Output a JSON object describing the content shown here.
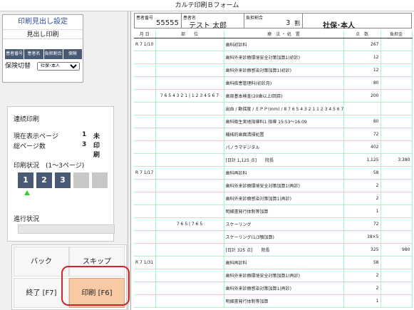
{
  "window": {
    "title": "カルテ印刷Ｂフォーム"
  },
  "settings": {
    "title": "印刷見出し設定",
    "subtitle": "見出し印刷",
    "tabs": [
      "患者番号",
      "患者名",
      "負担割合",
      "保険"
    ],
    "insurance_label": "保険切替",
    "insurance_selected": "社保･本人"
  },
  "continuous": {
    "title": "連続印刷",
    "current_label": "現在表示ページ",
    "current_value": "1",
    "current_status": "未印刷",
    "total_label": "総ページ数",
    "total_value": "3",
    "status_label": "印刷状況　(1〜3ページ)",
    "pages": [
      "1",
      "2",
      "3"
    ],
    "progress_label": "進行状況",
    "progress": 0
  },
  "buttons": {
    "back": "バック",
    "skip": "スキップ",
    "exit": "終了 [F7]",
    "print": "印刷 [F6]"
  },
  "header": {
    "patient_no_label": "患者番号",
    "patient_no": "55555",
    "patient_name_label": "患者名",
    "patient_name": "テスト 太郎",
    "ratio_label": "負担割合",
    "ratio": "3",
    "ratio_unit": "割",
    "insurance": "社保･本人"
  },
  "table": {
    "columns": [
      "月 日",
      "部　　位",
      "療　法 ・ 処　置",
      "点　数",
      "負担金"
    ],
    "rows": [
      {
        "date": "R 7 1/10",
        "part": "",
        "treat": "歯科初診料",
        "points": "267",
        "fee": ""
      },
      {
        "date": "",
        "part": "",
        "treat": "歯科外来診療環境安全対策加算1(初診)",
        "points": "12",
        "fee": ""
      },
      {
        "date": "",
        "part": "",
        "treat": "歯科外来診療感染対策加算1(初診)",
        "points": "12",
        "fee": ""
      },
      {
        "date": "",
        "part": "",
        "treat": "歯科疾患管理料(初診月)",
        "points": "80",
        "fee": ""
      },
      {
        "date": "",
        "part": "7 6 5 4 3 2 1 | 1 2 3 4 5 6 7",
        "treat": "歯周基本検査(20歯以上Ⅰ回目)",
        "points": "200",
        "fee": ""
      },
      {
        "date": "",
        "part": "",
        "treat": "出血 / 動揺度 / ＥＰＰ(mm) / 8 7 6 5 4 3 2 1 1 2 3 4 5 6 7 8 / ＥＰＰ(mm) / 動揺度 / 出血",
        "points": "",
        "fee": ""
      },
      {
        "date": "",
        "part": "",
        "treat": "歯科衛生実地指導料1 指導 15:53〜16:09",
        "points": "80",
        "fee": ""
      },
      {
        "date": "",
        "part": "",
        "treat": "機械的歯面清掃処置",
        "points": "72",
        "fee": ""
      },
      {
        "date": "",
        "part": "",
        "treat": "パノラマデジタル",
        "points": "402",
        "fee": ""
      },
      {
        "date": "",
        "part": "",
        "treat": "[日計 1,125 点]　　院長",
        "points": "1,125",
        "fee": "3,380"
      },
      {
        "date": "R 7 1/17",
        "part": "",
        "treat": "歯科再診料",
        "points": "58",
        "fee": ""
      },
      {
        "date": "",
        "part": "",
        "treat": "歯科外来診療環境安全対策加算1(再診)",
        "points": "2",
        "fee": ""
      },
      {
        "date": "",
        "part": "",
        "treat": "歯科外来診療感染対策加算1(再診)",
        "points": "2",
        "fee": ""
      },
      {
        "date": "",
        "part": "",
        "treat": "明細書発行体制等加算",
        "points": "1",
        "fee": ""
      },
      {
        "date": "",
        "part": "7 6 5 | 7 6 5",
        "treat": "スケーリング",
        "points": "72",
        "fee": ""
      },
      {
        "date": "",
        "part": "",
        "treat": "スケーリング(1/3顎加算)",
        "points": "38×5",
        "fee": ""
      },
      {
        "date": "",
        "part": "",
        "treat": "[日計 325 点]　　院長",
        "points": "325",
        "fee": "980"
      },
      {
        "date": "R 7 1/31",
        "part": "",
        "treat": "歯科再診料",
        "points": "58",
        "fee": ""
      },
      {
        "date": "",
        "part": "",
        "treat": "歯科外来診療環境安全対策加算1(再診)",
        "points": "2",
        "fee": ""
      },
      {
        "date": "",
        "part": "",
        "treat": "歯科外来診療感染対策加算1(再診)",
        "points": "2",
        "fee": ""
      },
      {
        "date": "",
        "part": "",
        "treat": "明細書発行体制等加算",
        "points": "1",
        "fee": ""
      }
    ]
  }
}
